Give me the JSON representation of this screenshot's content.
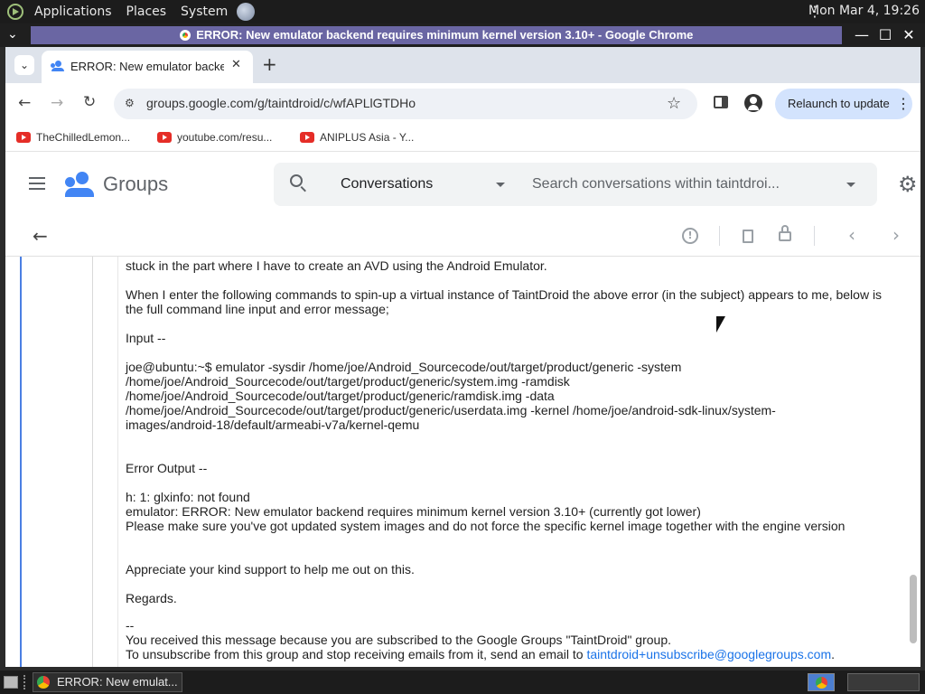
{
  "system_panel": {
    "menus": [
      "Applications",
      "Places",
      "System"
    ],
    "clock": "Mon Mar  4, 19:26"
  },
  "window": {
    "title": "ERROR: New emulator backend requires minimum kernel version 3.10+ - Google Chrome"
  },
  "browser": {
    "tab_title": "ERROR: New emulator backend requires minimum kernel version 3.10+",
    "url": "groups.google.com/g/taintdroid/c/wfAPLlGTDHo",
    "relaunch_label": "Relaunch to update",
    "bookmarks": [
      "TheChilledLemon...",
      "youtube.com/resu...",
      "ANIPLUS Asia - Y..."
    ]
  },
  "groups": {
    "brand": "Groups",
    "scope": "Conversations",
    "search_placeholder": "Search conversations within taintdroi..."
  },
  "message": {
    "lines": [
      "stuck in the part where I have to create an AVD using the Android Emulator.",
      "When I enter the following commands to spin-up a virtual instance of TaintDroid the above error (in the subject) appears to me, below is",
      "the full command line input and error message;",
      "Input --",
      "joe@ubuntu:~$ emulator -sysdir /home/joe/Android_Sourcecode/out/target/product/generic -system",
      "/home/joe/Android_Sourcecode/out/target/product/generic/system.img -ramdisk",
      "/home/joe/Android_Sourcecode/out/target/product/generic/ramdisk.img -data",
      "/home/joe/Android_Sourcecode/out/target/product/generic/userdata.img -kernel /home/joe/android-sdk-linux/system-",
      "images/android-18/default/armeabi-v7a/kernel-qemu",
      "Error Output --",
      "h: 1: glxinfo: not found",
      "emulator: ERROR: New emulator backend requires minimum kernel version 3.10+ (currently got lower)",
      "Please make sure you've got updated system images and do not force the specific kernel image together with the engine version",
      "Appreciate your kind support to help me out on this.",
      "Regards.",
      "--",
      "You received this message because you are subscribed to the Google Groups \"TaintDroid\" group.",
      "To unsubscribe from this group and stop receiving emails from it, send an email to "
    ],
    "unsubscribe_email": "taintdroid+unsubscribe@googlegroups.com",
    "unsubscribe_tail": "."
  },
  "taskbar": {
    "item_label": "ERROR: New emulat..."
  },
  "colors": {
    "title_bar": "#6a66a3",
    "relaunch_bg": "#d3e3fd",
    "link": "#1a73e8",
    "groups_blue": "#4285f4",
    "youtube_red": "#e52d27"
  }
}
